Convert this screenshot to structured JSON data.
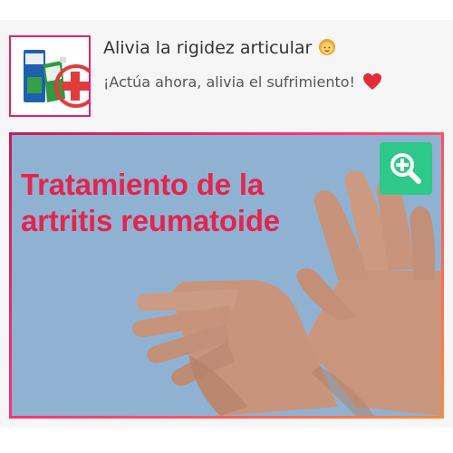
{
  "card": {
    "title": "Alivia la rigidez articular",
    "title_emoji": "woman-emoji-icon",
    "subtitle": "¡Actúa ahora, alivia el sufrimiento!",
    "subtitle_emoji": "heart-icon",
    "thumbnail_icon": "cream-tube-with-plus-icon"
  },
  "banner": {
    "headline_line1": "Tratamiento de la",
    "headline_line2": "artritis reumatoide",
    "zoom_icon": "magnify-plus-icon"
  },
  "colors": {
    "accent_pink": "#e6216f",
    "headline_red": "#e2254e",
    "zoom_green": "#2dc88a",
    "banner_bg": "#8fb2d3"
  }
}
